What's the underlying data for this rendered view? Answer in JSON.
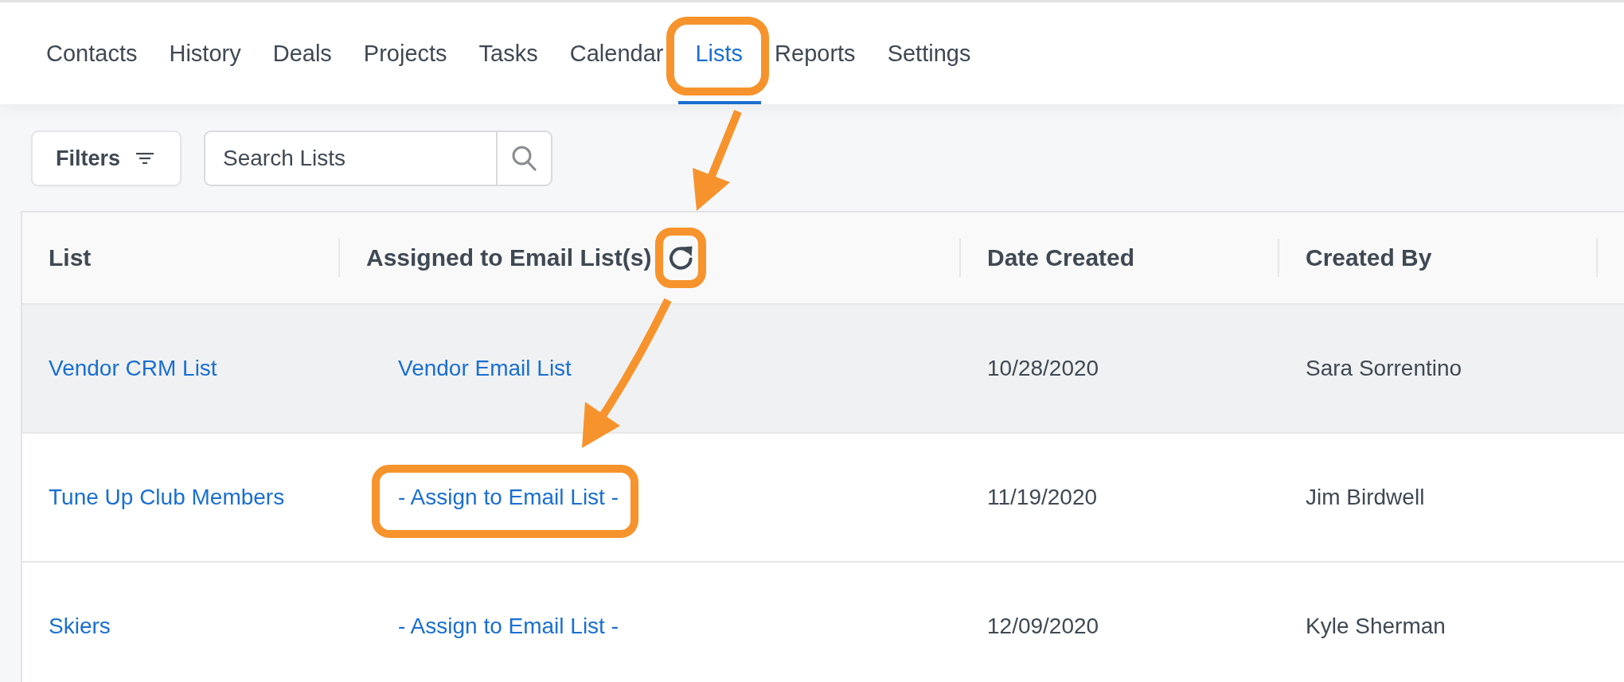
{
  "nav": {
    "tabs": [
      {
        "label": "Contacts",
        "selected": false,
        "callout": false
      },
      {
        "label": "History",
        "selected": false,
        "callout": false
      },
      {
        "label": "Deals",
        "selected": false,
        "callout": false
      },
      {
        "label": "Projects",
        "selected": false,
        "callout": false
      },
      {
        "label": "Tasks",
        "selected": false,
        "callout": false
      },
      {
        "label": "Calendar",
        "selected": false,
        "callout": false
      },
      {
        "label": "Lists",
        "selected": true,
        "callout": true
      },
      {
        "label": "Reports",
        "selected": false,
        "callout": false
      },
      {
        "label": "Settings",
        "selected": false,
        "callout": false
      }
    ]
  },
  "toolbar": {
    "filters_button": "Filters",
    "search": {
      "placeholder": "Search Lists"
    }
  },
  "table": {
    "columns": [
      {
        "label": "List",
        "kind": "plain",
        "callout": false
      },
      {
        "label": "Assigned to Email List(s)",
        "kind": "refresh",
        "callout": true
      },
      {
        "label": "Date Created",
        "kind": "plain",
        "callout": false
      },
      {
        "label": "Created By",
        "kind": "plain",
        "callout": false
      }
    ],
    "rows": [
      {
        "list": "Vendor CRM List",
        "email_list": "Vendor Email List",
        "date_created": "10/28/2020",
        "created_by": "Sara Sorrentino",
        "highlighted": true,
        "callout": false
      },
      {
        "list": "Tune Up Club Members",
        "email_list": "- Assign to Email List -",
        "date_created": "11/19/2020",
        "created_by": "Jim Birdwell",
        "highlighted": false,
        "callout": true
      },
      {
        "list": "Skiers",
        "email_list": "- Assign to Email List -",
        "date_created": "12/09/2020",
        "created_by": "Kyle Sherman",
        "highlighted": false,
        "callout": false
      }
    ]
  }
}
